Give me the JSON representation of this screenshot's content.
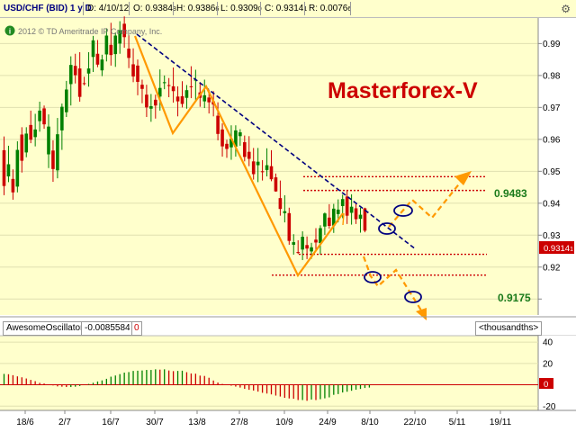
{
  "header": {
    "symbol": "USD/CHF (BID) 1 y D",
    "date": "D: 4/10/12",
    "open": "O: 0.9384",
    "open_suffix": "3",
    "high": "H: 0.9386",
    "high_suffix": "6",
    "low": "L: 0.9309",
    "low_suffix": "0",
    "close": "C: 0.9314",
    "close_suffix": "1",
    "range": "R: 0.0076",
    "range_suffix": "6"
  },
  "copyright": "2012 © TD Ameritrade IP Company, Inc.",
  "watermark": "Masterforex-V",
  "price_tag": {
    "value": "0.9314",
    "suffix": "1"
  },
  "indicator": {
    "name": "AwesomeOscillator",
    "value": "-0.0085584",
    "zero_label": "0",
    "units": "<thousandths>"
  },
  "colors": {
    "plot_bg": "#ffffcc",
    "up": "#008000",
    "down": "#cc0000",
    "trend": "#ff9900",
    "channel": "#000080",
    "level": "#cc0000",
    "watermark": "#cc0000",
    "projection": "#ff9900"
  },
  "chart_data": [
    {
      "type": "candlestick",
      "title": "",
      "ylim": [
        0.905,
        0.998
      ],
      "yticks": [
        0.91,
        0.92,
        0.93,
        0.94,
        0.95,
        0.96,
        0.97,
        0.98,
        0.99
      ],
      "ytick_labels": [
        "",
        "0.92",
        "0.93",
        "0.94",
        "0.95",
        "0.96",
        "0.97",
        "0.98",
        "0.99"
      ],
      "x_labels": [
        "18/6",
        "2/7",
        "16/7",
        "30/7",
        "13/8",
        "27/8",
        "10/9",
        "24/9",
        "8/10",
        "22/10",
        "5/11",
        "19/11"
      ],
      "bars": [
        [
          0.9566,
          0.9609,
          0.9425,
          0.9454
        ],
        [
          0.9484,
          0.958,
          0.9466,
          0.9522
        ],
        [
          0.9476,
          0.9506,
          0.9411,
          0.9434
        ],
        [
          0.9452,
          0.9594,
          0.9434,
          0.9567
        ],
        [
          0.9615,
          0.9638,
          0.9496,
          0.9533
        ],
        [
          0.9559,
          0.9638,
          0.9544,
          0.9618
        ],
        [
          0.9645,
          0.969,
          0.9588,
          0.9599
        ],
        [
          0.9607,
          0.968,
          0.9578,
          0.9631
        ],
        [
          0.9657,
          0.9718,
          0.9624,
          0.969
        ],
        [
          0.9697,
          0.9706,
          0.9633,
          0.9647
        ],
        [
          0.9553,
          0.9678,
          0.951,
          0.964
        ],
        [
          0.9565,
          0.9597,
          0.9467,
          0.9507
        ],
        [
          0.9503,
          0.9667,
          0.9478,
          0.9616
        ],
        [
          0.9628,
          0.9712,
          0.9567,
          0.9702
        ],
        [
          0.9685,
          0.9783,
          0.967,
          0.9756
        ],
        [
          0.9773,
          0.986,
          0.9706,
          0.9833
        ],
        [
          0.983,
          0.9868,
          0.9775,
          0.9801
        ],
        [
          0.9822,
          0.9873,
          0.9718,
          0.9733
        ],
        [
          0.9776,
          0.9796,
          0.9769,
          0.9775
        ],
        [
          0.9806,
          0.9873,
          0.9765,
          0.9822
        ],
        [
          0.9858,
          0.9924,
          0.9811,
          0.991
        ],
        [
          0.9868,
          0.9911,
          0.9826,
          0.9834
        ],
        [
          0.9816,
          0.9865,
          0.9798,
          0.985
        ],
        [
          0.9866,
          0.9948,
          0.9844,
          0.9925
        ],
        [
          0.9896,
          0.9965,
          0.9831,
          0.9864
        ],
        [
          0.9867,
          0.9935,
          0.9827,
          0.9925
        ],
        [
          0.99,
          0.997,
          0.9868,
          0.9942
        ],
        [
          0.9962,
          0.9985,
          0.9887,
          0.992
        ],
        [
          0.9884,
          0.9927,
          0.9823,
          0.9855
        ],
        [
          0.9835,
          0.9885,
          0.9779,
          0.9797
        ],
        [
          0.9831,
          0.985,
          0.9738,
          0.978
        ],
        [
          0.9771,
          0.9787,
          0.9713,
          0.9758
        ],
        [
          0.974,
          0.9771,
          0.967,
          0.97
        ],
        [
          0.9696,
          0.9742,
          0.9655,
          0.9704
        ],
        [
          0.9724,
          0.974,
          0.9665,
          0.9706
        ],
        [
          0.9734,
          0.9819,
          0.969,
          0.9761
        ],
        [
          0.9776,
          0.98,
          0.9757,
          0.9779
        ],
        [
          0.977,
          0.9792,
          0.9732,
          0.9767
        ],
        [
          0.9766,
          0.9825,
          0.9715,
          0.9751
        ],
        [
          0.9734,
          0.9766,
          0.9672,
          0.9719
        ],
        [
          0.9735,
          0.9782,
          0.97,
          0.9711
        ],
        [
          0.973,
          0.977,
          0.9696,
          0.9754
        ],
        [
          0.9766,
          0.9829,
          0.9729,
          0.9764
        ],
        [
          0.9784,
          0.9818,
          0.9723,
          0.9787
        ],
        [
          0.9747,
          0.9779,
          0.9702,
          0.973
        ],
        [
          0.9719,
          0.9787,
          0.9698,
          0.9738
        ],
        [
          0.9731,
          0.9755,
          0.9681,
          0.9716
        ],
        [
          0.9719,
          0.9751,
          0.9672,
          0.9709
        ],
        [
          0.9674,
          0.9716,
          0.9597,
          0.9617
        ],
        [
          0.9631,
          0.965,
          0.9546,
          0.9578
        ],
        [
          0.9586,
          0.9599,
          0.9542,
          0.957
        ],
        [
          0.9575,
          0.9644,
          0.9536,
          0.9602
        ],
        [
          0.9577,
          0.9644,
          0.9546,
          0.9628
        ],
        [
          0.961,
          0.9632,
          0.958,
          0.9622
        ],
        [
          0.9591,
          0.9612,
          0.9531,
          0.9545
        ],
        [
          0.9561,
          0.961,
          0.9516,
          0.9539
        ],
        [
          0.9531,
          0.9573,
          0.9474,
          0.9491
        ],
        [
          0.9519,
          0.9573,
          0.9466,
          0.953
        ],
        [
          0.95,
          0.9535,
          0.9471,
          0.9499
        ],
        [
          0.9504,
          0.9572,
          0.9484,
          0.9519
        ],
        [
          0.9516,
          0.9566,
          0.9469,
          0.9475
        ],
        [
          0.9481,
          0.9493,
          0.9436,
          0.9437
        ],
        [
          0.9416,
          0.9471,
          0.9361,
          0.9382
        ],
        [
          0.9369,
          0.9425,
          0.934,
          0.9375
        ],
        [
          0.9369,
          0.9386,
          0.927,
          0.9282
        ],
        [
          0.927,
          0.9303,
          0.9239,
          0.9278
        ],
        [
          0.9247,
          0.9284,
          0.9241,
          0.9245
        ],
        [
          0.9255,
          0.9312,
          0.9222,
          0.9295
        ],
        [
          0.9269,
          0.9296,
          0.9225,
          0.9258
        ],
        [
          0.9249,
          0.9276,
          0.9226,
          0.9262
        ],
        [
          0.9286,
          0.9322,
          0.925,
          0.9277
        ],
        [
          0.9275,
          0.9331,
          0.9239,
          0.9322
        ],
        [
          0.9327,
          0.9371,
          0.9301,
          0.9368
        ],
        [
          0.9355,
          0.9397,
          0.932,
          0.9329
        ],
        [
          0.933,
          0.9398,
          0.9307,
          0.9383
        ],
        [
          0.9366,
          0.9412,
          0.934,
          0.938
        ],
        [
          0.9391,
          0.9427,
          0.9353,
          0.9413
        ],
        [
          0.9421,
          0.944,
          0.9335,
          0.9361
        ],
        [
          0.937,
          0.9428,
          0.9333,
          0.9389
        ],
        [
          0.9384,
          0.9398,
          0.9335,
          0.935
        ],
        [
          0.9351,
          0.9386,
          0.9308,
          0.9364
        ],
        [
          0.9384,
          0.9386,
          0.9309,
          0.9314
        ]
      ],
      "levels": [
        {
          "value": 0.9483,
          "label": "0.9483"
        },
        {
          "value": 0.944,
          "label": ""
        },
        {
          "value": 0.924,
          "label": ""
        },
        {
          "value": 0.9175,
          "label": "0.9175"
        }
      ]
    },
    {
      "type": "bar",
      "title": "",
      "ylim": [
        -24,
        46
      ],
      "yticks": [
        40,
        20,
        0,
        -20
      ],
      "ytick_labels": [
        "40",
        "20",
        "",
        "-20"
      ],
      "values": [
        10.2,
        9.9,
        9.0,
        7.9,
        7.0,
        5.9,
        4.6,
        3.4,
        1.8,
        1.2,
        0.2,
        -0.6,
        -1.5,
        -1.8,
        -2.1,
        -2.1,
        -1.8,
        -1.1,
        -0.1,
        0.8,
        1.9,
        3.1,
        4.1,
        5.6,
        7.6,
        8.7,
        10.0,
        11.4,
        11.9,
        13.0,
        13.2,
        13.4,
        13.9,
        13.9,
        14.5,
        14.2,
        14.5,
        13.4,
        12.8,
        13.0,
        13.2,
        11.8,
        10.6,
        10.4,
        8.6,
        8.3,
        6.6,
        4.0,
        2.1,
        0.8,
        0.0,
        -0.8,
        -1.7,
        -2.6,
        -3.8,
        -4.7,
        -5.4,
        -6.4,
        -7.5,
        -8.2,
        -9.0,
        -10.1,
        -11.0,
        -12.2,
        -12.8,
        -13.1,
        -14.3,
        -14.3,
        -15.0,
        -13.8,
        -14.3,
        -13.5,
        -12.7,
        -11.8,
        -9.4,
        -8.7,
        -7.2,
        -6.5,
        -5.6,
        -4.6,
        -3.9,
        -3.0,
        -2.6
      ]
    }
  ]
}
